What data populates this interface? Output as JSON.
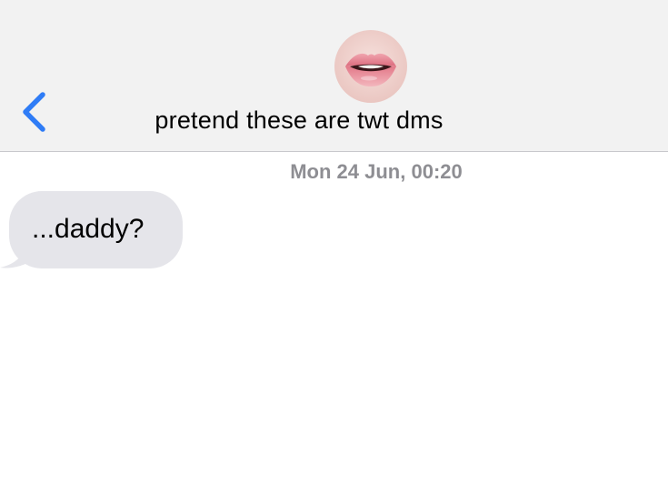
{
  "header": {
    "back_icon": "chevron-left-icon",
    "avatar": "lips-photo-avatar",
    "contact_name": "pretend these are twt dms"
  },
  "conversation": {
    "timestamp": "Mon 24 Jun, 00:20",
    "messages": [
      {
        "direction": "incoming",
        "text": "...daddy?"
      }
    ]
  },
  "colors": {
    "header_bg": "#f2f2f2",
    "accent": "#2f7cf6",
    "incoming_bubble": "#e5e5ea",
    "timestamp": "#8e8e93"
  }
}
